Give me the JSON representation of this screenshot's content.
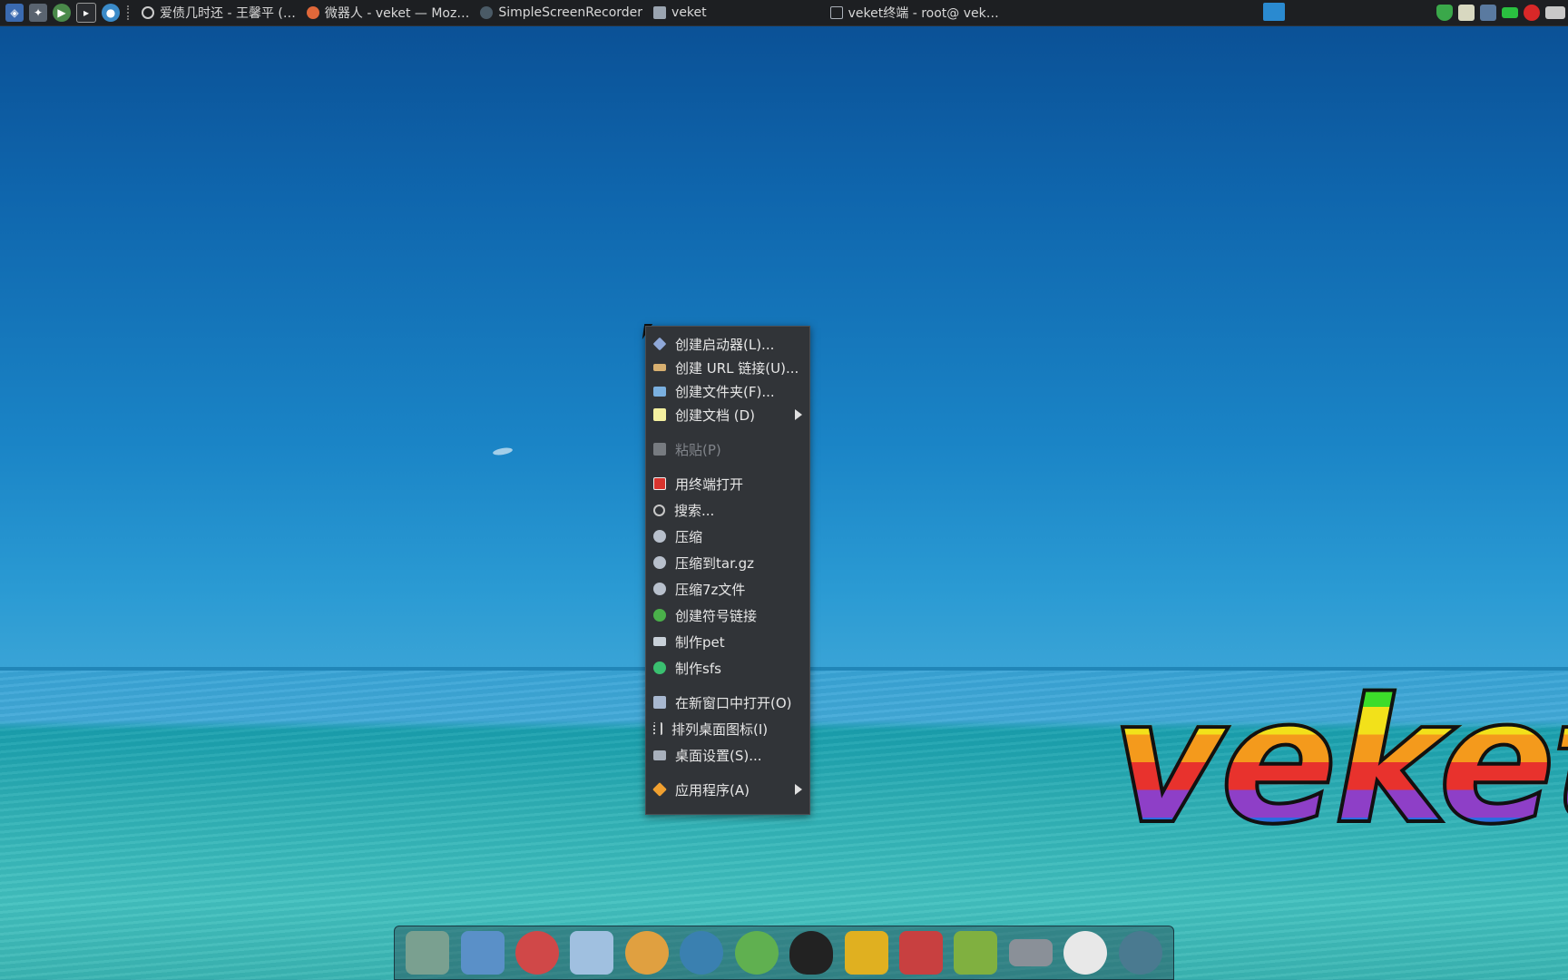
{
  "taskbar": {
    "tasks": [
      {
        "label": "爱债几时还 - 王馨平 (…",
        "icon": "music-icon",
        "color": "#c8c8c8"
      },
      {
        "label": "微器人 - veket — Moz…",
        "icon": "firefox-icon",
        "color": "#e0683a"
      },
      {
        "label": "SimpleScreenRecorder",
        "icon": "recorder-icon",
        "color": "#7a8a99"
      },
      {
        "label": "veket",
        "icon": "folder-icon",
        "color": "#9aa4b0"
      },
      {
        "label": "veket终端 - root@ vek…",
        "icon": "terminal-icon",
        "color": "#aab0b8"
      }
    ]
  },
  "context_menu": {
    "items": [
      {
        "label": "创建启动器(L)...",
        "icon": "launcher-icon",
        "color": "#8fa8d8"
      },
      {
        "label": "创建 URL 链接(U)...",
        "icon": "link-icon",
        "color": "#d8b070"
      },
      {
        "label": "创建文件夹(F)...",
        "icon": "folder-icon",
        "color": "#7ab0e0"
      },
      {
        "label": "创建文档 (D)",
        "icon": "document-icon",
        "color": "#f4f0a0",
        "submenu": true
      },
      {
        "label": "粘贴(P)",
        "icon": "paste-icon",
        "color": "#777b80",
        "disabled": true
      },
      {
        "label": "用终端打开",
        "icon": "terminal-icon",
        "color": "#d8342e"
      },
      {
        "label": "搜索...",
        "icon": "search-icon",
        "color": "#c8c8c8"
      },
      {
        "label": "压缩",
        "icon": "archive-icon",
        "color": "#b8c0cc"
      },
      {
        "label": "压缩到tar.gz",
        "icon": "archive-icon",
        "color": "#b8c0cc"
      },
      {
        "label": "压缩7z文件",
        "icon": "archive-icon",
        "color": "#b8c0cc"
      },
      {
        "label": "创建符号链接",
        "icon": "symlink-icon",
        "color": "#4ab04a"
      },
      {
        "label": "制作pet",
        "icon": "computer-icon",
        "color": "#c8d0d8"
      },
      {
        "label": "制作sfs",
        "icon": "recycle-icon",
        "color": "#3ac070"
      },
      {
        "label": "在新窗口中打开(O)",
        "icon": "window-icon",
        "color": "#a8b8d0"
      },
      {
        "label": "排列桌面图标(I)",
        "icon": "sort-icon",
        "color": "#d0d0d0"
      },
      {
        "label": "桌面设置(S)...",
        "icon": "desktop-settings-icon",
        "color": "#a8b0bc"
      },
      {
        "label": "应用程序(A)",
        "icon": "applications-icon",
        "color": "#f0a030",
        "submenu": true
      }
    ]
  },
  "watermark": {
    "text": "veket"
  },
  "dock": {
    "items": [
      {
        "icon": "system-icon",
        "color": "#7aa090"
      },
      {
        "icon": "monitor-icon",
        "color": "#5a90c8"
      },
      {
        "icon": "hedgehog-icon",
        "color": "#d04848"
      },
      {
        "icon": "editor-icon",
        "color": "#a0c0e0"
      },
      {
        "icon": "paint-icon",
        "color": "#e0a040"
      },
      {
        "icon": "media-player-icon",
        "color": "#3a80b0"
      },
      {
        "icon": "users-icon",
        "color": "#60b050"
      },
      {
        "icon": "qq-penguin-icon",
        "color": "#222222"
      },
      {
        "icon": "contacts-icon",
        "color": "#e0b020"
      },
      {
        "icon": "spreadsheet-icon",
        "color": "#c84040"
      },
      {
        "icon": "network-icon",
        "color": "#80b040"
      },
      {
        "icon": "drive-icon",
        "color": "#8a9098"
      },
      {
        "icon": "settings-sun-icon",
        "color": "#e8e8e8"
      },
      {
        "icon": "globe-icon",
        "color": "#4a7a90"
      }
    ]
  }
}
